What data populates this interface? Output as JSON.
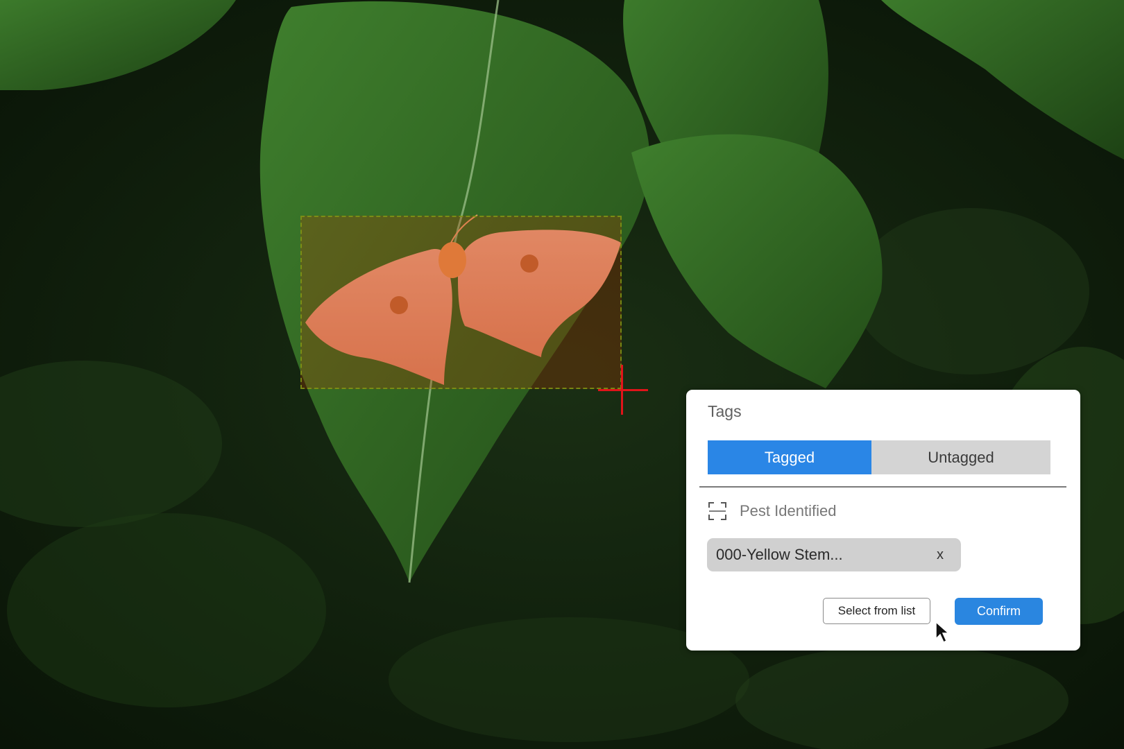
{
  "panel": {
    "title": "Tags",
    "tabs": {
      "tagged": "Tagged",
      "untagged": "Untagged",
      "active": "tagged"
    },
    "section_label": "Pest Identified",
    "chip": {
      "label": "000-Yellow Stem...",
      "close_label": "x"
    },
    "buttons": {
      "select_from_list": "Select from list",
      "confirm": "Confirm"
    }
  },
  "colors": {
    "accent": "#2a86e6",
    "annotation_fill": "#b43700",
    "crosshair": "#e0141a"
  },
  "icons": [
    "frame-select-icon",
    "mouse-pointer-icon",
    "close-icon"
  ]
}
